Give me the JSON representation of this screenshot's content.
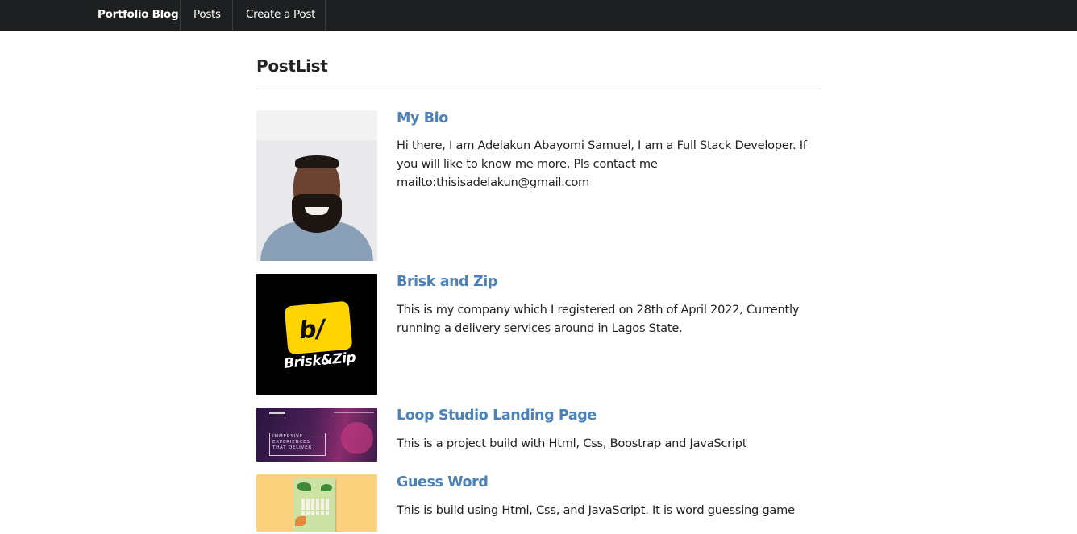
{
  "navbar": {
    "brand": "Portfolio Blog",
    "links": [
      {
        "label": "Posts"
      },
      {
        "label": "Create a Post"
      }
    ]
  },
  "page": {
    "title": "PostList"
  },
  "posts": [
    {
      "title": "My Bio",
      "body": "Hi there, I am Adelakun Abayomi Samuel, I am a Full Stack Developer. If you will like to know me more, Pls contact me mailto:thisisadelakun@gmail.com"
    },
    {
      "title": "Brisk and Zip",
      "body": "This is my company which I registered on 28th of April 2022, Currently running a delivery services around in Lagos State.",
      "thumb_logo_mark": "b/",
      "thumb_logo_text": "Brisk&Zip"
    },
    {
      "title": "Loop Studio Landing Page",
      "body": "This is a project build with Html, Css, Boostrap and JavaScript",
      "thumb_hero_text": "IMMERSIVE\nEXPERIENCES\nTHAT DELIVER"
    },
    {
      "title": "Guess Word",
      "body": "This is build using Html, Css, and JavaScript. It is word guessing game"
    }
  ],
  "colors": {
    "navbar_bg": "#1e1f20",
    "link": "#4d82b8",
    "brisk_yellow": "#ffd400"
  }
}
